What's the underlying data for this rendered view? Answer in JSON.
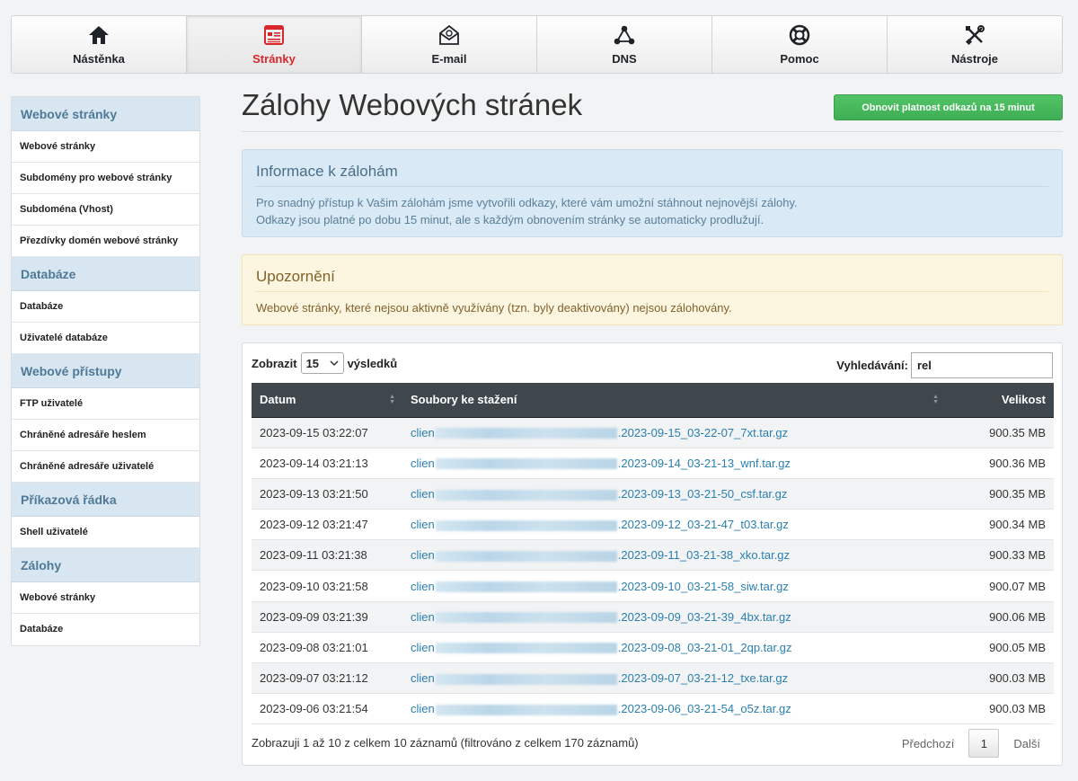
{
  "nav": [
    {
      "label": "Nástěnka",
      "icon": "home-icon",
      "active": false
    },
    {
      "label": "Stránky",
      "icon": "web-page-icon",
      "active": true
    },
    {
      "label": "E-mail",
      "icon": "email-icon",
      "active": false
    },
    {
      "label": "DNS",
      "icon": "network-icon",
      "active": false
    },
    {
      "label": "Pomoc",
      "icon": "lifebuoy-icon",
      "active": false
    },
    {
      "label": "Nástroje",
      "icon": "tools-icon",
      "active": false
    }
  ],
  "sidebar": {
    "sections": [
      {
        "title": "Webové stránky",
        "items": [
          "Webové stránky",
          "Subdomény pro webové stránky",
          "Subdoména (Vhost)",
          "Přezdívky domén webové stránky"
        ]
      },
      {
        "title": "Databáze",
        "items": [
          "Databáze",
          "Uživatelé databáze"
        ]
      },
      {
        "title": "Webové přístupy",
        "items": [
          "FTP uživatelé",
          "Chráněné adresáře heslem",
          "Chráněné adresáře uživatelé"
        ]
      },
      {
        "title": "Příkazová řádka",
        "items": [
          "Shell uživatelé"
        ]
      },
      {
        "title": "Zálohy",
        "items": [
          "Webové stránky",
          "Databáze"
        ]
      }
    ]
  },
  "main": {
    "title": "Zálohy Webových stránek",
    "refresh_button": "Obnovit platnost odkazů na 15 minut",
    "info": {
      "title": "Informace k zálohám",
      "line1": "Pro snadný přístup k Vašim zálohám jsme vytvořili odkazy, které vám umožní stáhnout nejnovější zálohy.",
      "line2": "Odkazy jsou platné po dobu 15 minut, ale s každým obnovením stránky se automaticky prodlužují."
    },
    "warning": {
      "title": "Upozornění",
      "text": "Webové stránky, které nejsou aktivně využívány (tzn. byly deaktivovány) nejsou zálohovány."
    }
  },
  "table": {
    "show_label": "Zobrazit",
    "page_size": "15",
    "results_label": "výsledků",
    "search_label": "Vyhledávání:",
    "search_value": "rel",
    "columns": [
      "Datum",
      "Soubory ke stažení",
      "Velikost"
    ],
    "rows": [
      {
        "date": "2023-09-15 03:22:07",
        "file_prefix": "clien",
        "file_suffix": ".2023-09-15_03-22-07_7xt.tar.gz",
        "size": "900.35 MB"
      },
      {
        "date": "2023-09-14 03:21:13",
        "file_prefix": "clien",
        "file_suffix": ".2023-09-14_03-21-13_wnf.tar.gz",
        "size": "900.36 MB"
      },
      {
        "date": "2023-09-13 03:21:50",
        "file_prefix": "clien",
        "file_suffix": ".2023-09-13_03-21-50_csf.tar.gz",
        "size": "900.35 MB"
      },
      {
        "date": "2023-09-12 03:21:47",
        "file_prefix": "clien",
        "file_suffix": ".2023-09-12_03-21-47_t03.tar.gz",
        "size": "900.34 MB"
      },
      {
        "date": "2023-09-11 03:21:38",
        "file_prefix": "clien",
        "file_suffix": ".2023-09-11_03-21-38_xko.tar.gz",
        "size": "900.33 MB"
      },
      {
        "date": "2023-09-10 03:21:58",
        "file_prefix": "clien",
        "file_suffix": ".2023-09-10_03-21-58_siw.tar.gz",
        "size": "900.07 MB"
      },
      {
        "date": "2023-09-09 03:21:39",
        "file_prefix": "clien",
        "file_suffix": ".2023-09-09_03-21-39_4bx.tar.gz",
        "size": "900.06 MB"
      },
      {
        "date": "2023-09-08 03:21:01",
        "file_prefix": "clien",
        "file_suffix": ".2023-09-08_03-21-01_2qp.tar.gz",
        "size": "900.05 MB"
      },
      {
        "date": "2023-09-07 03:21:12",
        "file_prefix": "clien",
        "file_suffix": ".2023-09-07_03-21-12_txe.tar.gz",
        "size": "900.03 MB"
      },
      {
        "date": "2023-09-06 03:21:54",
        "file_prefix": "clien",
        "file_suffix": ".2023-09-06_03-21-54_o5z.tar.gz",
        "size": "900.03 MB"
      }
    ],
    "info_text": "Zobrazuji 1 až 10 z celkem 10 záznamů (filtrováno z celkem 170 záznamů)",
    "prev_label": "Předchozí",
    "current_page": "1",
    "next_label": "Další"
  },
  "colors": {
    "accent_active": "#d9262c",
    "button_green": "#3fae55",
    "link": "#2a7fb0",
    "table_header": "#3f474d"
  }
}
